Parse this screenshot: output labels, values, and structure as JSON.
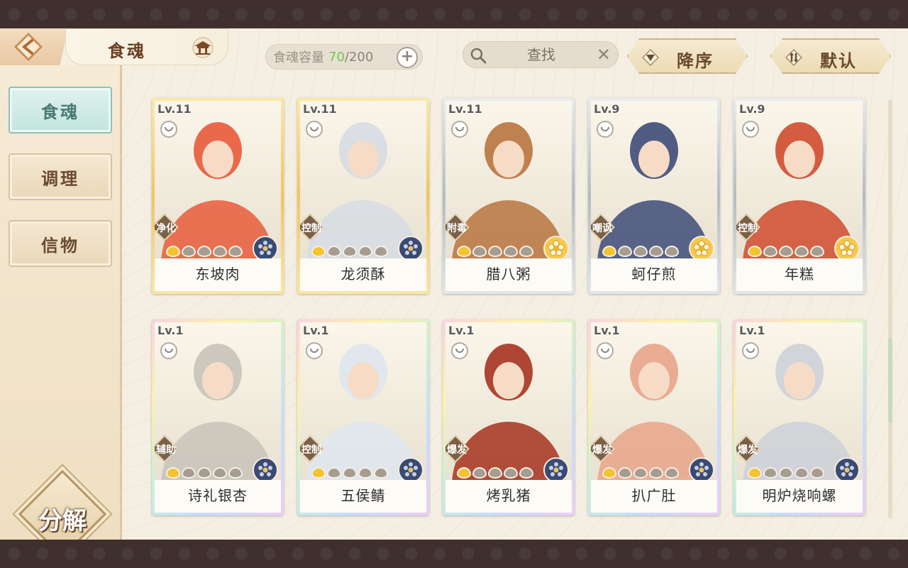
{
  "header": {
    "title": "食魂",
    "capacity": {
      "label": "食魂容量",
      "current": "70",
      "separator": "/",
      "max": "200"
    },
    "search": {
      "placeholder": "查找"
    },
    "sort_order": "降序",
    "sort_default": "默认"
  },
  "sidebar": {
    "tabs": [
      {
        "label": "食魂",
        "active": true
      },
      {
        "label": "调理",
        "active": false
      },
      {
        "label": "信物",
        "active": false
      }
    ],
    "decompose": "分解"
  },
  "cards": [
    {
      "level": "Lv.11",
      "role": "净化",
      "name": "东坡肉",
      "frame": "gold",
      "stars_on": 1,
      "emblem": "navy",
      "art": "#e85a3a"
    },
    {
      "level": "Lv.11",
      "role": "控制",
      "name": "龙须酥",
      "frame": "gold",
      "stars_on": 1,
      "emblem": "navy",
      "art": "#d7dce3"
    },
    {
      "level": "Lv.11",
      "role": "附毒",
      "name": "腊八粥",
      "frame": "silver",
      "stars_on": 1,
      "emblem": "amber",
      "art": "#b8743e"
    },
    {
      "level": "Lv.9",
      "role": "嘲讽",
      "name": "蚵仔煎",
      "frame": "silver",
      "stars_on": 1,
      "emblem": "amber",
      "art": "#3e4b78"
    },
    {
      "level": "Lv.9",
      "role": "控制",
      "name": "年糕",
      "frame": "silver",
      "stars_on": 1,
      "emblem": "amber",
      "art": "#cf4b2e"
    },
    {
      "level": "Lv.1",
      "role": "辅助",
      "name": "诗礼银杏",
      "frame": "rainbow",
      "stars_on": 1,
      "emblem": "navy",
      "art": "#c8c3b8"
    },
    {
      "level": "Lv.1",
      "role": "控制",
      "name": "五侯鲭",
      "frame": "rainbow",
      "stars_on": 1,
      "emblem": "navy",
      "art": "#dfe6ee"
    },
    {
      "level": "Lv.1",
      "role": "爆发",
      "name": "烤乳猪",
      "frame": "rainbow",
      "stars_on": 1,
      "emblem": "navy",
      "art": "#a5331f"
    },
    {
      "level": "Lv.1",
      "role": "爆发",
      "name": "扒广肚",
      "frame": "rainbow",
      "stars_on": 1,
      "emblem": "navy",
      "art": "#e8a48a"
    },
    {
      "level": "Lv.1",
      "role": "爆发",
      "name": "明炉烧响螺",
      "frame": "rainbow",
      "stars_on": 1,
      "emblem": "navy",
      "art": "#cdd0d8"
    }
  ]
}
